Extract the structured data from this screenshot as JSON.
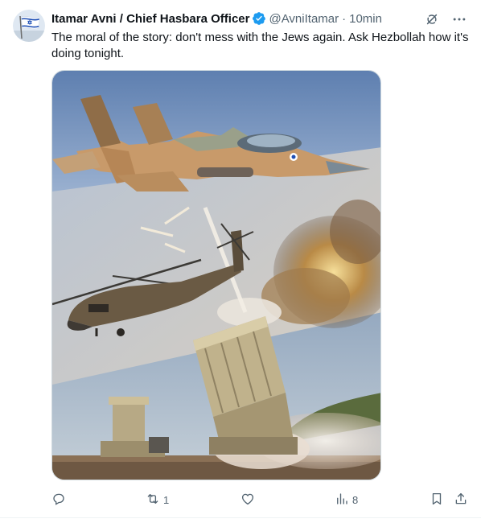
{
  "user": {
    "name": "Itamar Avni / Chief Hasbara Officer",
    "handle": "@AvniItamar",
    "separator": "·",
    "time": "10min"
  },
  "tweet": {
    "text": "The moral of the story: don't mess with the Jews again. Ask Hezbollah how it's doing tonight."
  },
  "actions": {
    "reply_count": "",
    "retweet_count": "1",
    "like_count": "",
    "views_count": "8"
  },
  "colors": {
    "accent": "#1d9bf0",
    "muted": "#536471",
    "text": "#0f1419"
  },
  "icons": {
    "header": [
      "grok-icon",
      "more-icon"
    ],
    "actions": [
      "reply-icon",
      "retweet-icon",
      "like-icon",
      "views-icon",
      "bookmark-icon",
      "share-icon"
    ]
  }
}
